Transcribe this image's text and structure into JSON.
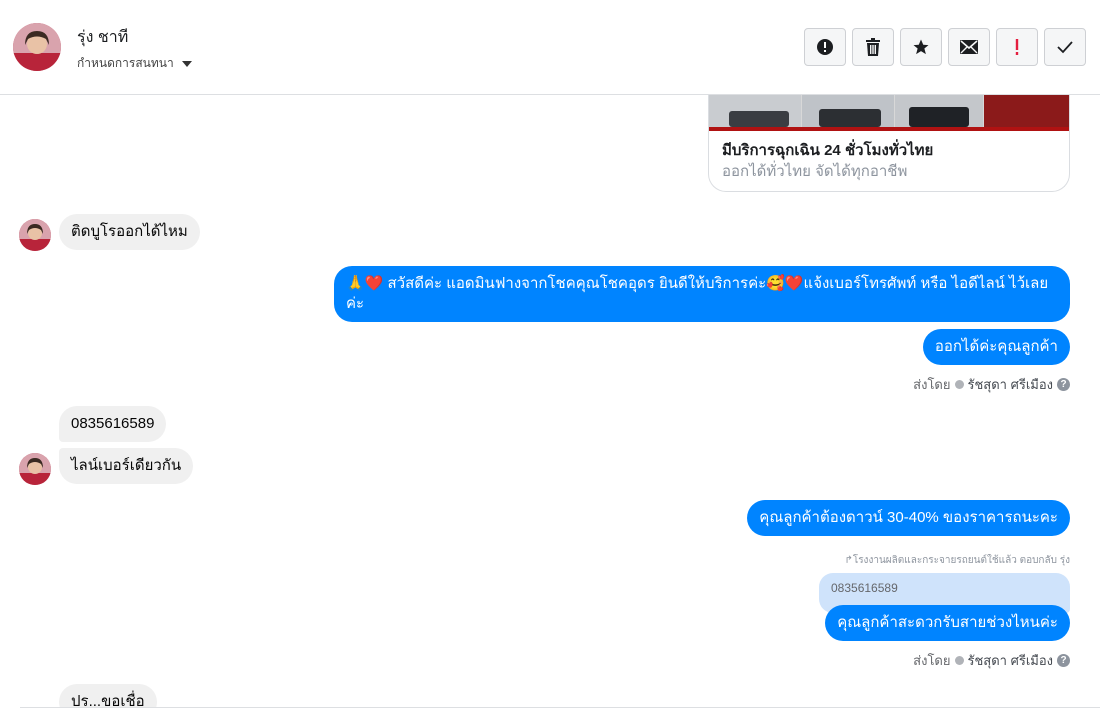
{
  "header": {
    "contact_name": "รุ่ง ชาที",
    "label_select": "กำหนดการสนทนา",
    "actions": [
      {
        "name": "mark-spam-button",
        "icon": "exclamation-circle-icon"
      },
      {
        "name": "delete-button",
        "icon": "trash-icon"
      },
      {
        "name": "star-button",
        "icon": "star-icon"
      },
      {
        "name": "mark-unread-button",
        "icon": "envelope-icon"
      },
      {
        "name": "follow-up-button",
        "icon": "exclamation-icon",
        "color": "#e41e3f"
      },
      {
        "name": "mark-done-button",
        "icon": "check-icon"
      }
    ]
  },
  "thread": {
    "card": {
      "title": "มีบริการฉุกเฉิน 24 ชั่วโมงทั่วไทย",
      "subtitle": "ออกได้ทั่วไทย จัดได้ทุกอาชีพ"
    },
    "msg_in_1": "ติดบูโรออกได้ไหม",
    "msg_out_1": "🙏❤️ สวัสดีค่ะ แอดมินฟางจากโชคคุณโชคอุดร ยินดีให้บริการค่ะ🥰❤️แจ้งเบอร์โทรศัพท์ หรือ ไอดีไลน์  ไว้เลยค่ะ",
    "msg_out_2": "ออกได้ค่ะคุณลูกค้า",
    "sent_by_1": {
      "prefix": "ส่งโดย",
      "name": "รัชสุดา ศรีเมือง"
    },
    "msg_in_2": "0835616589",
    "msg_in_3": "ไลน์เบอร์เดียวกัน",
    "msg_out_3": "คุณลูกค้าต้องดาวน์ 30-40% ของราคารถนะคะ",
    "reply_note": "↱โรงงานผลิตและกระจายรถยนต์ใช้แล้ว ตอบกลับ รุ่ง",
    "quoted": "0835616589",
    "msg_out_4": "คุณลูกค้าสะดวกรับสายช่วงไหนค่ะ",
    "sent_by_2": {
      "prefix": "ส่งโดย",
      "name": "รัชสุดา ศรีเมือง"
    },
    "msg_in_4_partial": "ปร...ขอเชื่อ"
  },
  "colors": {
    "outgoing": "#0084ff",
    "incoming": "#f0f0f0",
    "follow_up": "#e41e3f"
  }
}
